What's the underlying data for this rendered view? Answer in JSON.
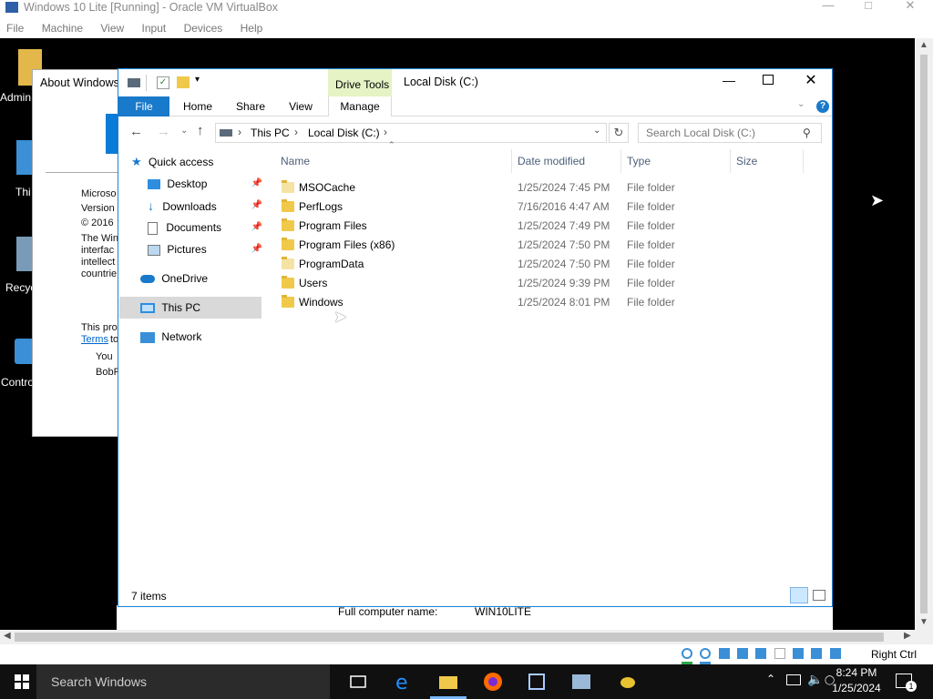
{
  "vbox": {
    "title": "Windows 10 Lite [Running] - Oracle VM VirtualBox",
    "menu": [
      "File",
      "Machine",
      "View",
      "Input",
      "Devices",
      "Help"
    ],
    "host_key": "Right Ctrl"
  },
  "desktop": {
    "icons": [
      {
        "label": "Admin"
      },
      {
        "label": "Thi"
      },
      {
        "label": "Recyc"
      },
      {
        "label": "Contro"
      }
    ]
  },
  "about": {
    "title": "About Windows",
    "lines": [
      "Microso",
      "Version",
      "© 2016",
      "The Win",
      "interfac",
      "intellect",
      "countrie"
    ],
    "program_text": "This pro",
    "terms_link": "Terms",
    "terms_suffix": "to",
    "you": "You",
    "user": "BobP"
  },
  "explorer": {
    "title": "Local Disk (C:)",
    "context_tab": "Drive Tools",
    "tabs": {
      "file": "File",
      "home": "Home",
      "share": "Share",
      "view": "View",
      "manage": "Manage"
    },
    "breadcrumb": [
      "This PC",
      "Local Disk (C:)"
    ],
    "search_placeholder": "Search Local Disk (C:)",
    "nav": {
      "quick_access": "Quick access",
      "desktop": "Desktop",
      "downloads": "Downloads",
      "documents": "Documents",
      "pictures": "Pictures",
      "onedrive": "OneDrive",
      "this_pc": "This PC",
      "network": "Network"
    },
    "columns": {
      "name": "Name",
      "date": "Date modified",
      "type": "Type",
      "size": "Size"
    },
    "rows": [
      {
        "name": "MSOCache",
        "date": "1/25/2024 7:45 PM",
        "type": "File folder"
      },
      {
        "name": "PerfLogs",
        "date": "7/16/2016 4:47 AM",
        "type": "File folder"
      },
      {
        "name": "Program Files",
        "date": "1/25/2024 7:49 PM",
        "type": "File folder"
      },
      {
        "name": "Program Files (x86)",
        "date": "1/25/2024 7:50 PM",
        "type": "File folder"
      },
      {
        "name": "ProgramData",
        "date": "1/25/2024 7:50 PM",
        "type": "File folder"
      },
      {
        "name": "Users",
        "date": "1/25/2024 9:39 PM",
        "type": "File folder"
      },
      {
        "name": "Windows",
        "date": "1/25/2024 8:01 PM",
        "type": "File folder"
      }
    ],
    "status": "7 items"
  },
  "sysinfo": {
    "label": "Full computer name:",
    "value": "WIN10LITE"
  },
  "taskbar": {
    "search": "Search Windows",
    "time": "8:24 PM",
    "date": "1/25/2024",
    "notif_count": "1"
  },
  "colors": {
    "accent": "#1979ca",
    "selection": "#cce8ff",
    "drive_tools": "#e5f3c5",
    "folder": "#f0c94a"
  }
}
